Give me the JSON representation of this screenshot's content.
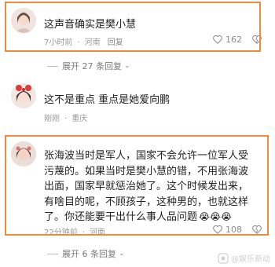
{
  "comments": [
    {
      "text": "这声音确实是樊小慧",
      "time": "7小时前",
      "location": "河南",
      "reply": "回复",
      "likes": "162",
      "expand": "展开 27 条回复"
    },
    {
      "text": "这不是重点 重点是她爱向鹏",
      "time": "刚刚",
      "location": "重庆"
    },
    {
      "lines": [
        "张海波当时是军人，国家不会允许一位军人受",
        "污蔑的。如果当时是樊小慧的错，不用张海波",
        "出面，国家早就惩治她了。这个时候发出来，",
        "有啥目的呢，不顾孩子，这种男的，也就这样",
        "了。你还能要干出什么事人品问题"
      ],
      "time": "22分钟前",
      "location": "河南",
      "likes": "108",
      "expand": "展开 6 条回复"
    }
  ],
  "watermark": "@娱乐新动"
}
